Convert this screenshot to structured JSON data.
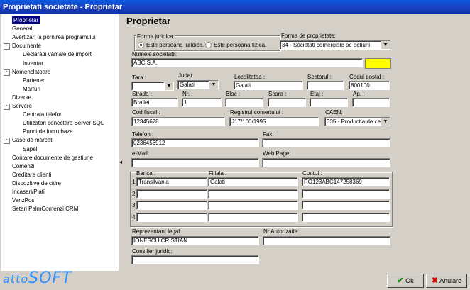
{
  "window": {
    "title": "Proprietati societate - Proprietar"
  },
  "tree": {
    "items": [
      {
        "label": "Proprietar",
        "level": 0,
        "selected": true
      },
      {
        "label": "General",
        "level": 0
      },
      {
        "label": "Avertizari la pornirea programului",
        "level": 0
      },
      {
        "label": "Documente",
        "level": 0,
        "expander": "-"
      },
      {
        "label": "Declaratii vamale de import",
        "level": 1
      },
      {
        "label": "Inventar",
        "level": 1
      },
      {
        "label": "Nomenclatoare",
        "level": 0,
        "expander": "-"
      },
      {
        "label": "Parteneri",
        "level": 1
      },
      {
        "label": "Marfuri",
        "level": 1
      },
      {
        "label": "Diverse",
        "level": 0
      },
      {
        "label": "Servere",
        "level": 0,
        "expander": "-"
      },
      {
        "label": "Centrala telefon",
        "level": 1
      },
      {
        "label": "Utilizatori conectare Server SQL",
        "level": 1
      },
      {
        "label": "Punct de lucru baza",
        "level": 1
      },
      {
        "label": "Case de marcat",
        "level": 0,
        "expander": "-"
      },
      {
        "label": "Sapel",
        "level": 1
      },
      {
        "label": "Contare documente de gestiune",
        "level": 0
      },
      {
        "label": "Comenzi",
        "level": 0
      },
      {
        "label": "Creditare clienti",
        "level": 0
      },
      {
        "label": "Dispozitive de citire",
        "level": 0
      },
      {
        "label": "Incasari/Plati",
        "level": 0
      },
      {
        "label": "VanzPos",
        "level": 0
      },
      {
        "label": "Setari PalmComenzi CRM",
        "level": 0
      }
    ]
  },
  "panel": {
    "title": "Proprietar",
    "forma_juridica": {
      "label": "Forma juridica:",
      "opt1": "Este persoana juridica.",
      "opt2": "Este persoana fizica."
    },
    "forma_proprietate": {
      "label": "Forma de proprietate:",
      "value": "34 - Societati comerciale pe actiuni"
    },
    "numele": {
      "label": "Numele societatii:",
      "value": "ABC S.A."
    },
    "tara": {
      "label": "Tara :",
      "value": ""
    },
    "judet": {
      "label": "Judet",
      "value": "Galati"
    },
    "localitatea": {
      "label": "Localitatea :",
      "value": "Galati"
    },
    "sectorul": {
      "label": "Sectorul :",
      "value": ""
    },
    "cod_postal": {
      "label": "Codul postal :",
      "value": "800100"
    },
    "strada": {
      "label": "Strada :",
      "value": "Brailei"
    },
    "nr": {
      "label": "Nr. :",
      "value": "1"
    },
    "bloc": {
      "label": "Bloc :",
      "value": ""
    },
    "scara": {
      "label": "Scara :",
      "value": ""
    },
    "etaj": {
      "label": "Etaj :",
      "value": ""
    },
    "ap": {
      "label": "Ap. :",
      "value": ""
    },
    "cod_fiscal": {
      "label": "Cod fiscal :",
      "value": "12345678"
    },
    "registrul": {
      "label": "Registrul comertului :",
      "value": "J17/100/1995"
    },
    "caen": {
      "label": "CAEN:",
      "value": "335 - Productia de cea"
    },
    "telefon": {
      "label": "Telefon :",
      "value": "0236456912"
    },
    "fax": {
      "label": "Fax:",
      "value": ""
    },
    "email": {
      "label": "e-Mail:",
      "value": ""
    },
    "webpage": {
      "label": "Web Page:",
      "value": ""
    },
    "banca_label": "Banca :",
    "filiala_label": "Filiala :",
    "contul_label": "Contul :",
    "banks": [
      {
        "n": "1.",
        "banca": "Transilvania",
        "filiala": "Galati",
        "contul": "RO123ABC147258369"
      },
      {
        "n": "2.",
        "banca": "",
        "filiala": "",
        "contul": ""
      },
      {
        "n": "3.",
        "banca": "",
        "filiala": "",
        "contul": ""
      },
      {
        "n": "4.",
        "banca": "",
        "filiala": "",
        "contul": ""
      }
    ],
    "reprezentant": {
      "label": "Reprezentant legal:",
      "value": "IONESCU CRISTIAN"
    },
    "nr_autorizatie": {
      "label": "Nr.Autorizatie:",
      "value": ""
    },
    "consilier": {
      "label": "Consilier juridic:",
      "value": ""
    }
  },
  "footer": {
    "logo_a": "atto",
    "logo_b": "SOFT",
    "ok_label": "Ok",
    "cancel_label": "Anulare"
  },
  "colors": {
    "title_bar": "#0a4ad6",
    "selection": "#000080",
    "required_highlight": "#ffff00",
    "logo": "#2f8fff"
  }
}
